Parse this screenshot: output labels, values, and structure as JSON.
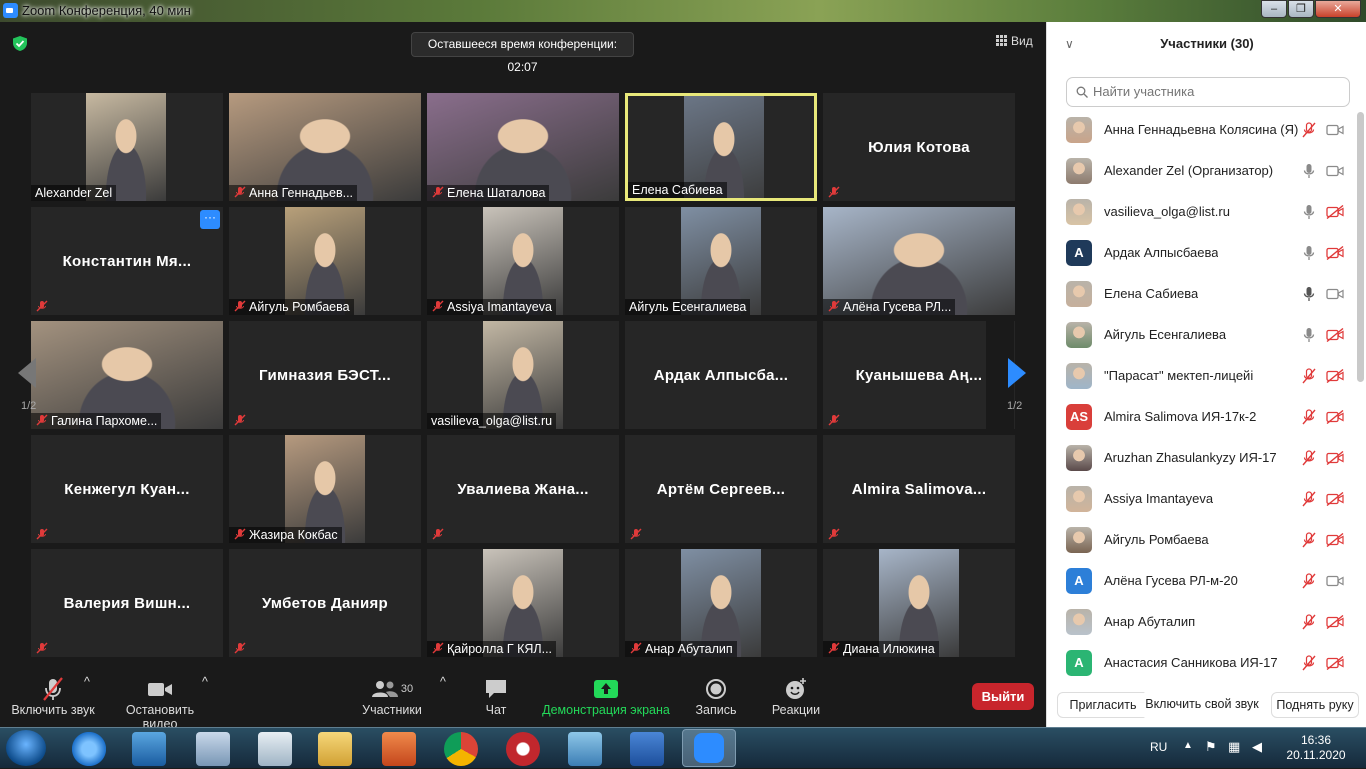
{
  "window": {
    "title": "Zoom Конференция, 40 мин",
    "min": "–",
    "max": "❐",
    "close": "✕"
  },
  "header": {
    "timer": "Оставшееся время конференции: 02:07",
    "view_label": "Вид"
  },
  "nav": {
    "page_left": "1/2",
    "page_right": "1/2"
  },
  "tiles": [
    {
      "name": "Alexander Zel",
      "video": true,
      "muted": false
    },
    {
      "name": "Анна Геннадьев...",
      "video": true,
      "muted": true
    },
    {
      "name": "Елена Шаталова",
      "video": true,
      "muted": true
    },
    {
      "name": "Елена Сабиева",
      "video": true,
      "muted": false,
      "active": true
    },
    {
      "name": "Юлия Котова",
      "video": false,
      "muted": true
    },
    {
      "name": "Константин Мя...",
      "video": false,
      "muted": true,
      "more": "···"
    },
    {
      "name": "Айгуль Ромбаева",
      "video": true,
      "muted": true
    },
    {
      "name": "Assiya Imantayeva",
      "video": true,
      "muted": true
    },
    {
      "name": "Айгуль Есенгалиева",
      "video": true,
      "muted": false
    },
    {
      "name": "Алёна Гусева РЛ...",
      "video": true,
      "muted": true
    },
    {
      "name": "Галина Пархоме...",
      "video": true,
      "muted": true
    },
    {
      "name": "Гимназия БЭСТ...",
      "video": false,
      "muted": true
    },
    {
      "name": "vasilieva_olga@list.ru",
      "video": true,
      "muted": false
    },
    {
      "name": "Ардак Алпысба...",
      "video": false,
      "muted": false
    },
    {
      "name": "Куанышева Аң...",
      "video": false,
      "muted": true
    },
    {
      "name": "Кенжегул Куан...",
      "video": false,
      "muted": true
    },
    {
      "name": "Жазира Кокбас",
      "video": true,
      "muted": true
    },
    {
      "name": "Увалиева Жана...",
      "video": false,
      "muted": true
    },
    {
      "name": "Артём Сергеев...",
      "video": false,
      "muted": true
    },
    {
      "name": "Almira Salimova...",
      "video": false,
      "muted": true
    },
    {
      "name": "Валерия Вишн...",
      "video": false,
      "muted": true
    },
    {
      "name": "Умбетов Данияр",
      "video": false,
      "muted": true
    },
    {
      "name": "Қайролла Г КЯЛ...",
      "video": true,
      "muted": true
    },
    {
      "name": "Анар Абуталип",
      "video": true,
      "muted": true
    },
    {
      "name": "Диана Илюкина",
      "video": true,
      "muted": true
    }
  ],
  "toolbar": {
    "unmute": "Включить звук",
    "stop_video": "Остановить видео",
    "participants": "Участники",
    "participants_count": "30",
    "chat": "Чат",
    "share": "Демонстрация экрана",
    "record": "Запись",
    "reactions": "Реакции",
    "leave": "Выйти",
    "share_color": "#23d959",
    "leave_color": "#c8252c"
  },
  "panel": {
    "title": "Участники (30)",
    "search_placeholder": "Найти участника",
    "participants": [
      {
        "name": "Анна Геннадьевна Колясина (Я)",
        "avatar": "photo",
        "mic": "muted",
        "cam": "on"
      },
      {
        "name": "Alexander Zel (Организатор)",
        "avatar": "photo",
        "mic": "on",
        "cam": "on"
      },
      {
        "name": "vasilieva_olga@list.ru",
        "avatar": "photo",
        "mic": "on",
        "cam": "off"
      },
      {
        "name": "Ардак Алпысбаева",
        "avatar": "A",
        "avatar_color": "#1f3a5a",
        "mic": "on",
        "cam": "off"
      },
      {
        "name": "Елена Сабиева",
        "avatar": "photo",
        "mic": "active",
        "cam": "on"
      },
      {
        "name": "Айгуль Есенгалиева",
        "avatar": "photo",
        "mic": "on",
        "cam": "off"
      },
      {
        "name": "\"Парасат\" мектеп-лицейі",
        "avatar": "photo",
        "mic": "muted",
        "cam": "off"
      },
      {
        "name": "Almira Salimova ИЯ-17к-2",
        "avatar": "AS",
        "avatar_color": "#d93f3a",
        "mic": "muted",
        "cam": "off"
      },
      {
        "name": "Aruzhan Zhasulankyzy ИЯ-17",
        "avatar": "photo",
        "mic": "muted",
        "cam": "off"
      },
      {
        "name": "Assiya Imantayeva",
        "avatar": "photo",
        "mic": "muted",
        "cam": "off"
      },
      {
        "name": "Айгуль Ромбаева",
        "avatar": "photo",
        "mic": "muted",
        "cam": "off"
      },
      {
        "name": "Алёна Гусева РЛ-м-20",
        "avatar": "A",
        "avatar_color": "#2d7fd8",
        "mic": "muted",
        "cam": "on"
      },
      {
        "name": "Анар Абуталип",
        "avatar": "photo",
        "mic": "muted",
        "cam": "off"
      },
      {
        "name": "Анастасия Санникова ИЯ-17",
        "avatar": "A",
        "avatar_color": "#2bb573",
        "mic": "muted",
        "cam": "off"
      }
    ],
    "invite": "Пригласить",
    "unmute_me": "Включить свой звук",
    "raise_hand": "Поднять руку"
  },
  "taskbar": {
    "lang": "RU",
    "time": "16:36",
    "date": "20.11.2020"
  }
}
